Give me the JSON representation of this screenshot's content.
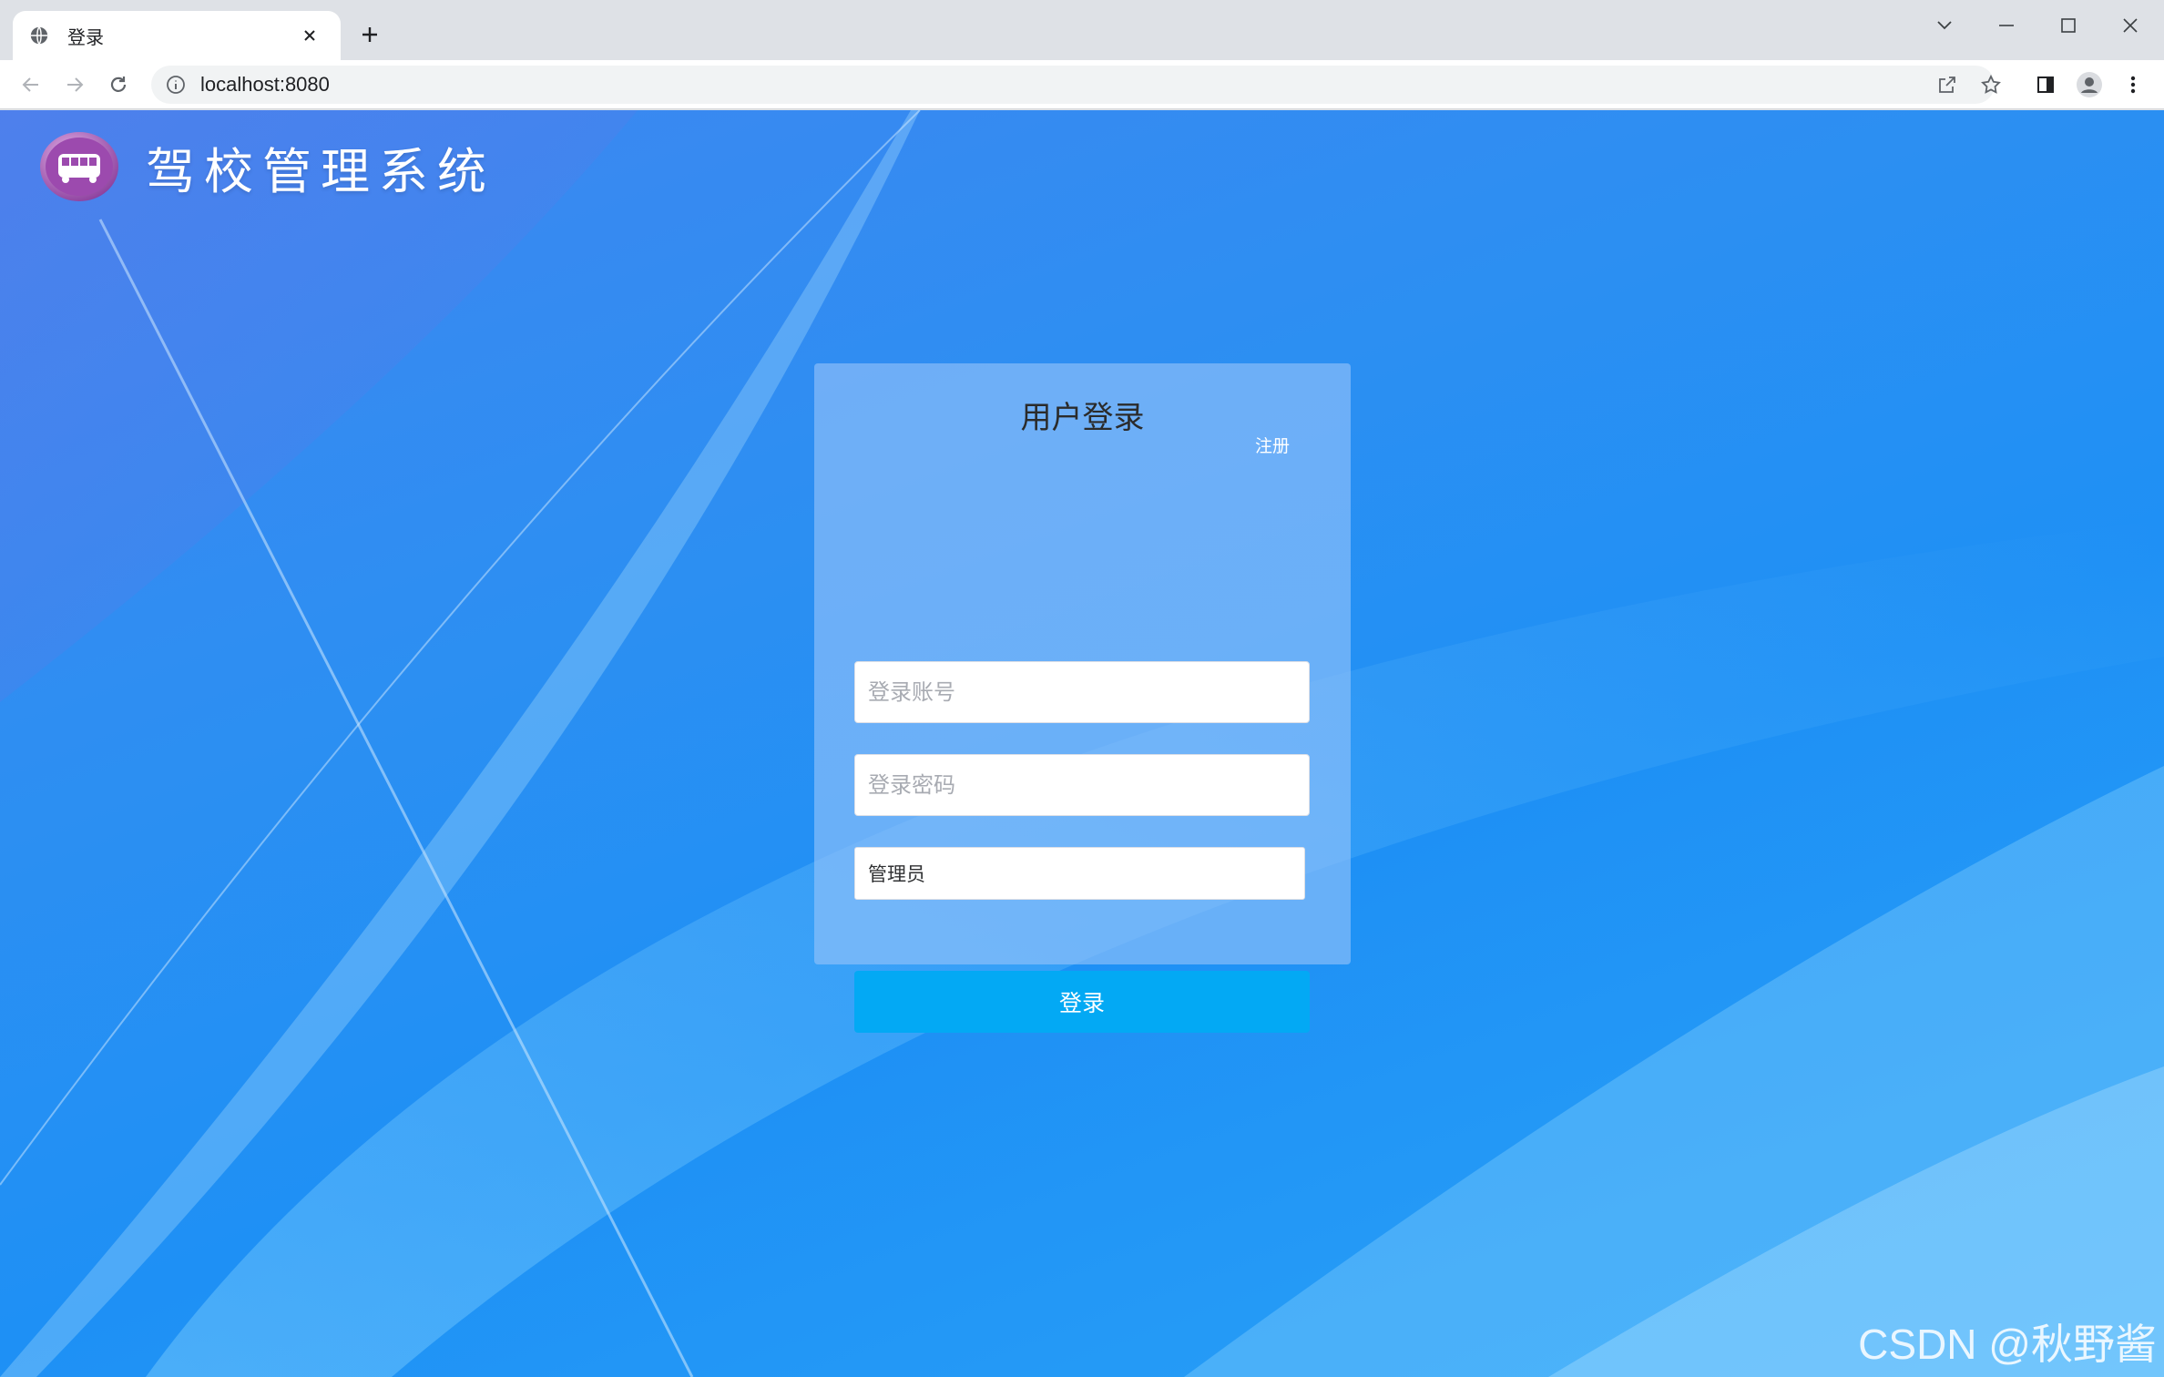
{
  "browser": {
    "tab_title": "登录",
    "url": "localhost:8080",
    "favicon": "globe-icon",
    "colors": {
      "chrome_bg": "#dee1e6",
      "omnibox_bg": "#f1f3f4"
    }
  },
  "page": {
    "brand_title": "驾校管理系统",
    "brand_logo": "bus-icon",
    "login": {
      "title": "用户登录",
      "register_link": "注册",
      "username_placeholder": "登录账号",
      "username_value": "",
      "password_placeholder": "登录密码",
      "password_value": "",
      "role_selected": "管理员",
      "submit_label": "登录"
    },
    "watermark": "CSDN @秋野酱",
    "colors": {
      "background": "#2c8ff2",
      "button": "#03a9f4",
      "card": "#96c3fa"
    }
  }
}
